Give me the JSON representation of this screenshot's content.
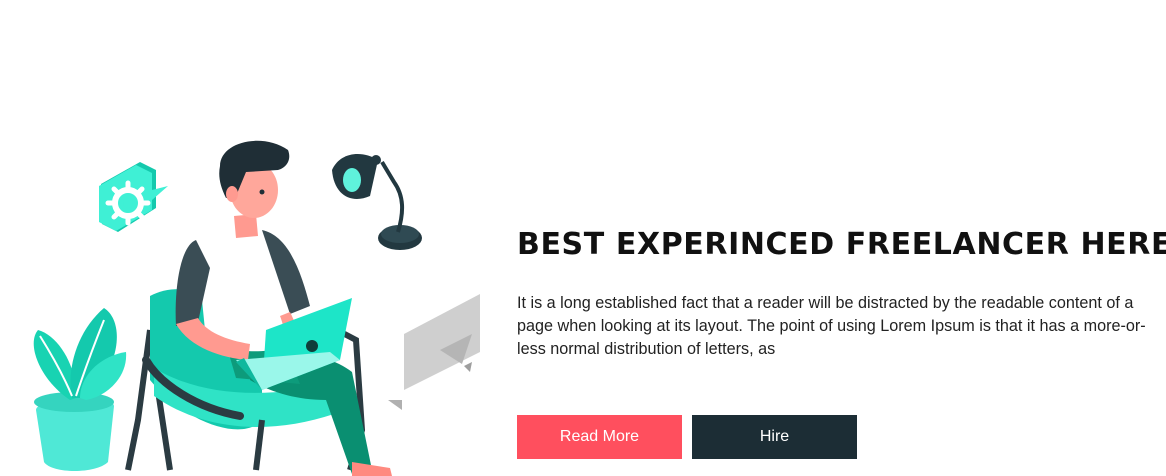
{
  "hero": {
    "headline": "BEST EXPERINCED FREELANCER HERE",
    "body": "It is a long established fact that a reader will be distracted by the readable content of a page when looking at its layout. The point of using Lorem Ipsum is that it has a more-or-less normal distribution of letters, as",
    "read_more_label": "Read More",
    "hire_label": "Hire"
  },
  "colors": {
    "accent": "#ff4f5e",
    "dark": "#1c2d35",
    "teal": "#1de5c8"
  },
  "icons": [
    "gear-icon",
    "desk-lamp-icon",
    "plant-icon",
    "laptop-icon"
  ]
}
